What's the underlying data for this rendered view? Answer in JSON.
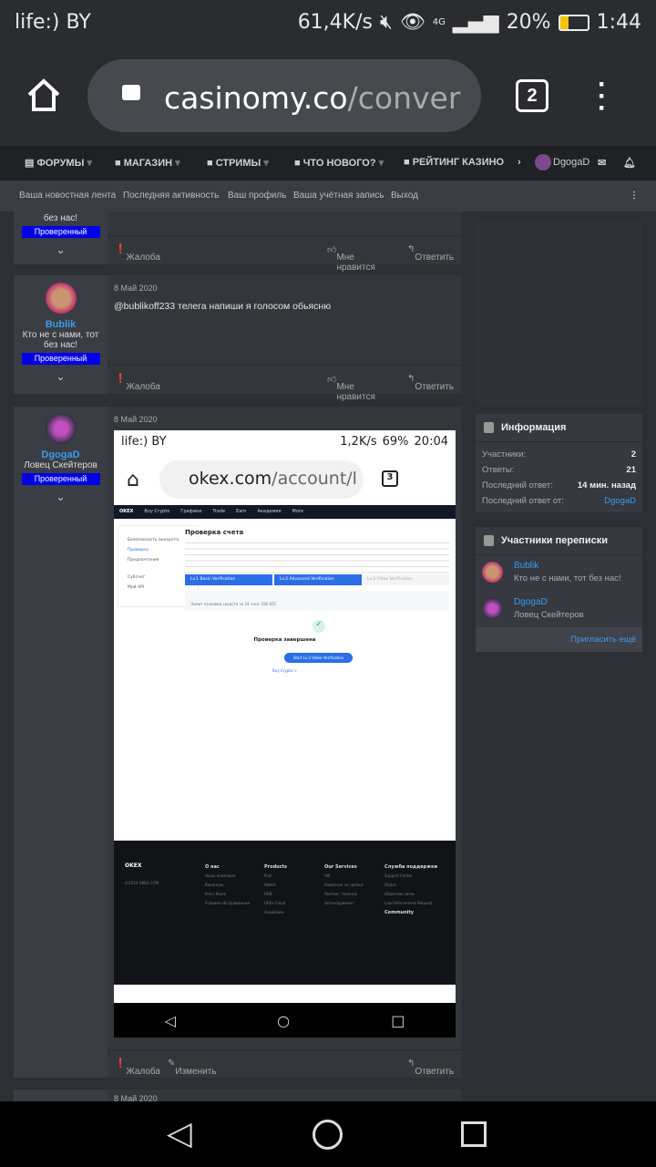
{
  "status_bar": {
    "carrier": "life:) BY",
    "speed": "61,4K/s",
    "network": "4G",
    "battery": "20%",
    "time": "1:44"
  },
  "browser": {
    "url_domain": "casinomy.co",
    "url_path": "/conver",
    "tab_count": "2"
  },
  "nav": {
    "items": [
      "ФОРУМЫ",
      "МАГАЗИН",
      "СТРИМЫ",
      "ЧТО НОВОГО?",
      "РЕЙТИНГ КАЗИНО"
    ],
    "user": "DgogaD"
  },
  "subnav": [
    "Ваша новостная лента",
    "Последняя активность",
    "Ваш профиль",
    "Ваша учётная запись",
    "Выход"
  ],
  "actions": {
    "report": "Жалоба",
    "like": "Мне нравится",
    "reply": "Ответить",
    "edit": "Изменить"
  },
  "posts": [
    {
      "title_tail": "без нас!",
      "badge": "Проверенный"
    },
    {
      "user": "Bublik",
      "title": "Кто не с нами, тот без нас!",
      "badge": "Проверенный",
      "date": "8 Май 2020",
      "text": "@bublikoff233 телега напиши я голосом обьясню"
    },
    {
      "user": "DgogaD",
      "title": "Ловец Скейтеров",
      "badge": "Проверенный",
      "date": "8 Май 2020"
    },
    {
      "date": "8 Май 2020"
    }
  ],
  "embedded_screenshot": {
    "carrier": "life:) BY",
    "speed": "1,2K/s",
    "battery": "69%",
    "time": "20:04",
    "url_domain": "okex.com",
    "url_path": "/account/l",
    "tab_count": "3",
    "logo": "OKEX",
    "nav": [
      "Buy Crypto",
      "Графики",
      "Trade",
      "Earn",
      "Академия",
      "More"
    ],
    "side": [
      "Безопасность аккаунта",
      "Проверка",
      "Предпочтения",
      "Субсчет",
      "Мой API"
    ],
    "title": "Проверка счета",
    "steps": [
      "Lv.1 Basic Verification",
      "Lv.2 Advanced Verification",
      "Lv.3 Video Verification"
    ],
    "limit": "Лимит на вывод средств за 24 часа: 500 BTC",
    "done": "Проверка завершена",
    "start_btn": "Start Lv.3 Video Verification",
    "buy": "Buy Crypto >",
    "footer_cols": [
      {
        "h": "О нас",
        "items": [
          "Наша компания",
          "Вакансии",
          "Press Room",
          "Условия обслуживания"
        ]
      },
      {
        "h": "Products",
        "items": [
          "Pool",
          "Wallet",
          "OKB",
          "OKEx Cloud",
          "Академия"
        ]
      },
      {
        "h": "Our Services",
        "items": [
          "API",
          "Комиссия за сделки",
          "Листинг токенов",
          "Автоапрувмент"
        ]
      },
      {
        "h": "Служба поддержки",
        "items": [
          "Support Center",
          "Status",
          "Обратная связь",
          "Law Enforcement Request"
        ]
      }
    ],
    "community": "Community",
    "copyright": "©2020 OKEX.COM"
  },
  "sidebar": {
    "info_title": "Информация",
    "info": [
      {
        "k": "Участники:",
        "v": "2"
      },
      {
        "k": "Ответы:",
        "v": "21"
      },
      {
        "k": "Последний ответ:",
        "v": "14 мин. назад"
      },
      {
        "k": "Последний ответ от:",
        "v": "DgogaD"
      }
    ],
    "participants_title": "Участники переписки",
    "participants": [
      {
        "name": "Bublik",
        "title": "Кто не с нами, тот без нас!"
      },
      {
        "name": "DgogaD",
        "title": "Ловец Скейтеров"
      }
    ],
    "invite": "Пригласить ещё"
  }
}
